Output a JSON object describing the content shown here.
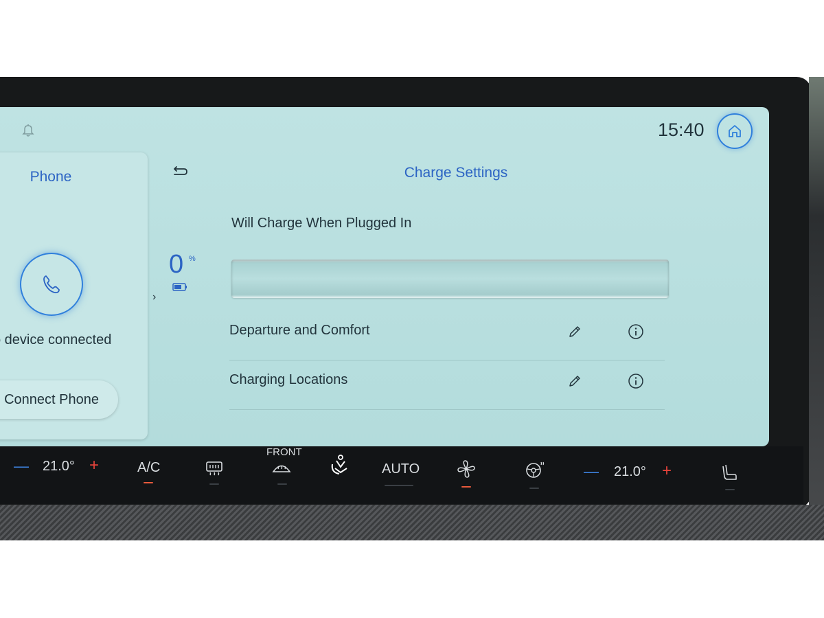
{
  "status": {
    "time": "15:40"
  },
  "icons": {
    "notification": "bell-icon",
    "home": "home-icon",
    "phone": "phone-icon",
    "back": "back-arrow-icon",
    "battery": "battery-icon",
    "edit": "pencil-icon",
    "info": "info-icon"
  },
  "phone_card": {
    "title": "Phone",
    "status": "o device connected",
    "button": "Connect Phone"
  },
  "charge": {
    "title": "Charge Settings",
    "battery_percent": "0",
    "battery_unit": "%",
    "status": "Will Charge When Plugged In",
    "progress_fraction": 0,
    "options": [
      {
        "label": "Departure and Comfort"
      },
      {
        "label": "Charging Locations"
      }
    ]
  },
  "climate": {
    "left_minus": "—",
    "left_temp": "21.0°",
    "left_plus": "+",
    "ac": "A/C",
    "front_label": "FRONT",
    "auto": "AUTO",
    "right_minus": "—",
    "right_temp": "21.0°",
    "right_plus": "+"
  },
  "colors": {
    "accent": "#2f7fdc",
    "title_blue": "#2c64c4",
    "indicator_on": "#e85a3c",
    "screen_bg": "#bfe3e3"
  }
}
